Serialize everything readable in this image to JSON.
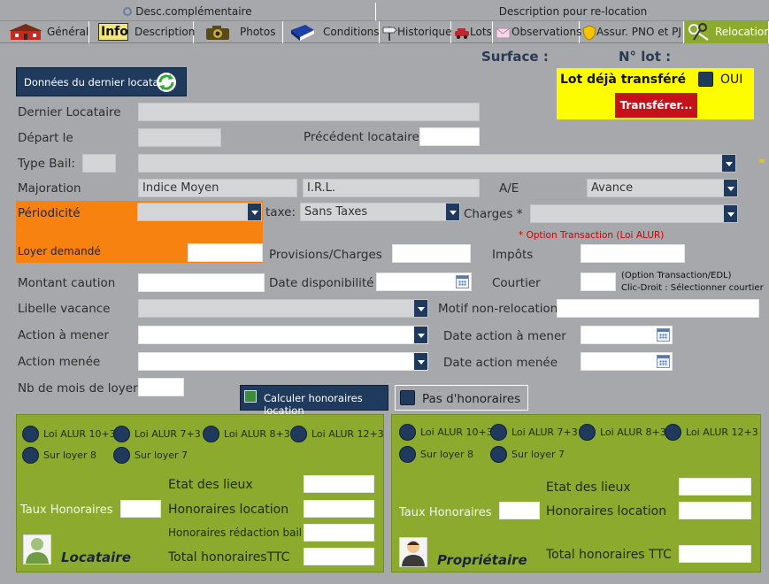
{
  "subtabs": {
    "left": "Desc.complémentaire",
    "right": "Description pour re-location"
  },
  "tabs": [
    {
      "label": "Général",
      "icon": "house-icon"
    },
    {
      "label": "Description",
      "icon": "info-icon"
    },
    {
      "label": "Photos",
      "icon": "camera-icon"
    },
    {
      "label": "Conditions",
      "icon": "book-icon"
    },
    {
      "label": "Historique",
      "icon": "signpost-icon"
    },
    {
      "label": "Lots",
      "icon": "car-icon"
    },
    {
      "label": "Observations",
      "icon": "envelope-icon"
    },
    {
      "label": "Assur. PNO et PJ",
      "icon": "shield-icon"
    },
    {
      "label": "Relocation",
      "icon": "keys-icon",
      "active": true
    }
  ],
  "header": {
    "surface_label": "Surface :",
    "lot_label": "N° lot :"
  },
  "last_tenant_button": "Données du dernier locataire",
  "transfer": {
    "label": "Lot déjà transféré",
    "checkbox_label": "OUI",
    "button": "Transférer..."
  },
  "form": {
    "dernier_locataire": {
      "label": "Dernier Locataire",
      "value": ""
    },
    "depart": {
      "label": "Départ le",
      "value": ""
    },
    "precedent": {
      "label": "Précédent locataire",
      "value": ""
    },
    "type_bail": {
      "label": "Type Bail:",
      "code": "",
      "value": ""
    },
    "majoration": {
      "label": "Majoration",
      "indice": "Indice Moyen",
      "irl": "I.R.L."
    },
    "ae": {
      "label": "A/E",
      "value": "Avance"
    },
    "periodicite": {
      "label": "Périodicité",
      "value": ""
    },
    "taxe": {
      "label": "taxe:",
      "value": "Sans Taxes"
    },
    "charges": {
      "label": "Charges *",
      "value": "",
      "note": "* Option Transaction (Loi ALUR)"
    },
    "loyer": {
      "label": "Loyer demandé",
      "value": ""
    },
    "provisions": {
      "label": "Provisions/Charges",
      "value": ""
    },
    "impots": {
      "label": "Impôts",
      "value": ""
    },
    "caution": {
      "label": "Montant caution",
      "value": ""
    },
    "date_dispo": {
      "label": "Date disponibilité",
      "value": ""
    },
    "courtier": {
      "label": "Courtier",
      "value": "",
      "note1": "(Option Transaction/EDL)",
      "note2": "Clic-Droit : Sélectionner courtier"
    },
    "libelle_vacance": {
      "label": "Libelle vacance",
      "value": ""
    },
    "motif": {
      "label": "Motif non-relocation",
      "value": ""
    },
    "action_a_mener": {
      "label": "Action à mener",
      "value": ""
    },
    "date_action_a_mener": {
      "label": "Date action à mener",
      "value": ""
    },
    "action_menee": {
      "label": "Action menée",
      "value": ""
    },
    "date_action_menee": {
      "label": "Date action menée",
      "value": ""
    },
    "nb_mois": {
      "label": "Nb de mois de loyer",
      "value": ""
    }
  },
  "calc_button": "Calculer honoraires location",
  "no_fees": "Pas d'honoraires",
  "radios": [
    "Loi ALUR 10+3",
    "Loi ALUR 7+3",
    "Loi ALUR 8+3",
    "Loi ALUR 12+3",
    "Sur loyer 8",
    "Sur loyer 7"
  ],
  "locataire": {
    "role": "Locataire",
    "taux": "Taux Honoraires",
    "etat": "Etat des lieux",
    "hon_loc": "Honoraires location",
    "hon_red": "Honoraires rédaction bail",
    "total": "Total honorairesTTC"
  },
  "proprietaire": {
    "role": "Propriétaire",
    "taux": "Taux Honoraires",
    "etat": "Etat des lieux",
    "hon_loc": "Honoraires location",
    "total": "Total honoraires TTC"
  },
  "colors": {
    "background": "#a7a8ab",
    "accent_green": "#8cab2e",
    "orange": "#f7820f",
    "yellow": "#fdfd00",
    "navy": "#1f3a5c",
    "transfer_red": "#c4121b"
  }
}
